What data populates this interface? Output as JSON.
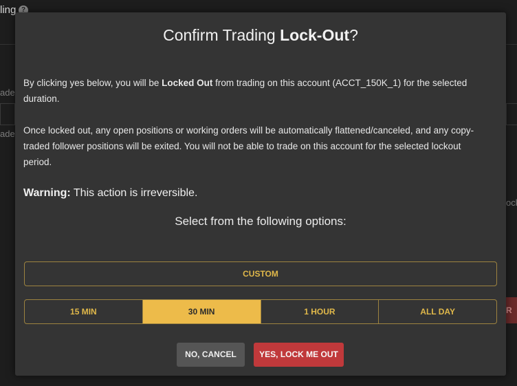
{
  "background": {
    "title_fragment": "ling",
    "help_icon": "?",
    "side_labels": [
      "ades",
      "ades"
    ],
    "right_fragment": "ock",
    "red_button_fragment": "R D"
  },
  "modal": {
    "title_prefix": "Confirm Trading ",
    "title_bold": "Lock-Out",
    "title_suffix": "?",
    "para1": {
      "before": "By clicking yes below, you will be ",
      "bold": "Locked Out",
      "after": " from trading on this account (ACCT_150K_1) for the selected duration."
    },
    "para2": "Once locked out, any open positions or working orders will be automatically flattened/canceled, and any copy-traded follower positions will be exited. You will not be able to trade on this account for the selected lockout period.",
    "warning_label": "Warning:",
    "warning_text": " This action is irreversible.",
    "select_label": "Select from the following options:",
    "custom_label": "CUSTOM",
    "durations": [
      {
        "label": "15 MIN",
        "selected": false
      },
      {
        "label": "30 MIN",
        "selected": true
      },
      {
        "label": "1 HOUR",
        "selected": false
      },
      {
        "label": "ALL DAY",
        "selected": false
      }
    ],
    "cancel_label": "NO, CANCEL",
    "confirm_label": "YES, LOCK ME OUT"
  },
  "colors": {
    "accent_gold": "#edbb4a",
    "danger_red": "#c0393b",
    "modal_bg": "#343434"
  }
}
